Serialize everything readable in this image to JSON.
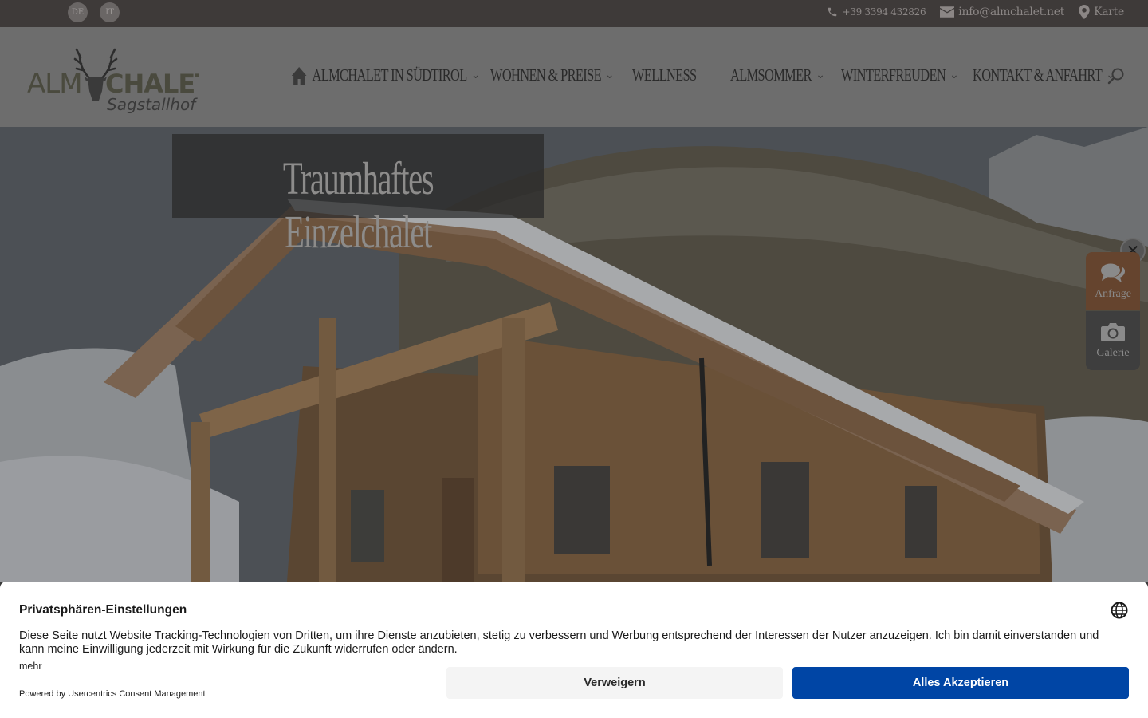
{
  "topbar": {
    "languages": [
      "DE",
      "IT"
    ],
    "phone": "+39 3394 432826",
    "email": "info@almchalet.net",
    "map": "Karte"
  },
  "logo": {
    "name": "ALMCHALET",
    "subtitle": "Sagstallhof"
  },
  "nav": {
    "items": [
      {
        "label": "ALMCHALET IN SÜDTIROL",
        "has_dropdown": true,
        "icon": "home-icon"
      },
      {
        "label": "WOHNEN & PREISE",
        "has_dropdown": true
      },
      {
        "label": "WELLNESS",
        "has_dropdown": false
      },
      {
        "label": "ALMSOMMER",
        "has_dropdown": true
      },
      {
        "label": "WINTERFREUDEN",
        "has_dropdown": true
      },
      {
        "label": "KONTAKT & ANFAHRT",
        "has_dropdown": true
      }
    ],
    "chevron": "⌄"
  },
  "hero": {
    "title": "Traumhaftes Einzelchalet"
  },
  "side_widget": {
    "close_glyph": "✕",
    "anfrage": "Anfrage",
    "galerie": "Galerie"
  },
  "consent": {
    "title": "Privatsphären-Einstellungen",
    "text": "Diese Seite nutzt Website Tracking-Technologien von Dritten, um ihre Dienste anzubieten, stetig zu verbessern und Werbung entsprechend der Interessen der Nutzer anzuzeigen. Ich bin damit einverstanden und kann meine Einwilligung jederzeit mit Wirkung für die Zukunft widerrufen oder ändern.",
    "more": "mehr",
    "powered": "Powered by Usercentrics Consent Management",
    "deny_label": "Verweigern",
    "accept_label": "Alles Akzeptieren"
  },
  "colors": {
    "topbar_bg": "#3e3a39",
    "header_bg": "#6d6d6d",
    "accept_blue": "#0045a5",
    "anfrage_brown": "#65442e"
  }
}
